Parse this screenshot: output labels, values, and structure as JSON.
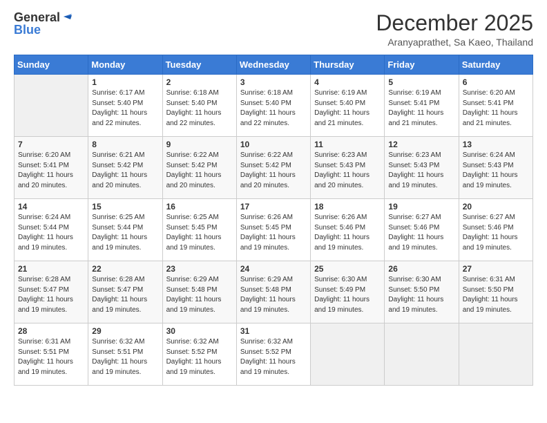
{
  "header": {
    "logo_general": "General",
    "logo_blue": "Blue",
    "title": "December 2025",
    "subtitle": "Aranyaprathet, Sa Kaeo, Thailand"
  },
  "weekdays": [
    "Sunday",
    "Monday",
    "Tuesday",
    "Wednesday",
    "Thursday",
    "Friday",
    "Saturday"
  ],
  "weeks": [
    [
      {
        "day": "",
        "empty": true
      },
      {
        "day": "1",
        "sunrise": "6:17 AM",
        "sunset": "5:40 PM",
        "daylight": "11 hours and 22 minutes."
      },
      {
        "day": "2",
        "sunrise": "6:18 AM",
        "sunset": "5:40 PM",
        "daylight": "11 hours and 22 minutes."
      },
      {
        "day": "3",
        "sunrise": "6:18 AM",
        "sunset": "5:40 PM",
        "daylight": "11 hours and 22 minutes."
      },
      {
        "day": "4",
        "sunrise": "6:19 AM",
        "sunset": "5:40 PM",
        "daylight": "11 hours and 21 minutes."
      },
      {
        "day": "5",
        "sunrise": "6:19 AM",
        "sunset": "5:41 PM",
        "daylight": "11 hours and 21 minutes."
      },
      {
        "day": "6",
        "sunrise": "6:20 AM",
        "sunset": "5:41 PM",
        "daylight": "11 hours and 21 minutes."
      }
    ],
    [
      {
        "day": "7",
        "sunrise": "6:20 AM",
        "sunset": "5:41 PM",
        "daylight": "11 hours and 20 minutes."
      },
      {
        "day": "8",
        "sunrise": "6:21 AM",
        "sunset": "5:42 PM",
        "daylight": "11 hours and 20 minutes."
      },
      {
        "day": "9",
        "sunrise": "6:22 AM",
        "sunset": "5:42 PM",
        "daylight": "11 hours and 20 minutes."
      },
      {
        "day": "10",
        "sunrise": "6:22 AM",
        "sunset": "5:42 PM",
        "daylight": "11 hours and 20 minutes."
      },
      {
        "day": "11",
        "sunrise": "6:23 AM",
        "sunset": "5:43 PM",
        "daylight": "11 hours and 20 minutes."
      },
      {
        "day": "12",
        "sunrise": "6:23 AM",
        "sunset": "5:43 PM",
        "daylight": "11 hours and 19 minutes."
      },
      {
        "day": "13",
        "sunrise": "6:24 AM",
        "sunset": "5:43 PM",
        "daylight": "11 hours and 19 minutes."
      }
    ],
    [
      {
        "day": "14",
        "sunrise": "6:24 AM",
        "sunset": "5:44 PM",
        "daylight": "11 hours and 19 minutes."
      },
      {
        "day": "15",
        "sunrise": "6:25 AM",
        "sunset": "5:44 PM",
        "daylight": "11 hours and 19 minutes."
      },
      {
        "day": "16",
        "sunrise": "6:25 AM",
        "sunset": "5:45 PM",
        "daylight": "11 hours and 19 minutes."
      },
      {
        "day": "17",
        "sunrise": "6:26 AM",
        "sunset": "5:45 PM",
        "daylight": "11 hours and 19 minutes."
      },
      {
        "day": "18",
        "sunrise": "6:26 AM",
        "sunset": "5:46 PM",
        "daylight": "11 hours and 19 minutes."
      },
      {
        "day": "19",
        "sunrise": "6:27 AM",
        "sunset": "5:46 PM",
        "daylight": "11 hours and 19 minutes."
      },
      {
        "day": "20",
        "sunrise": "6:27 AM",
        "sunset": "5:46 PM",
        "daylight": "11 hours and 19 minutes."
      }
    ],
    [
      {
        "day": "21",
        "sunrise": "6:28 AM",
        "sunset": "5:47 PM",
        "daylight": "11 hours and 19 minutes."
      },
      {
        "day": "22",
        "sunrise": "6:28 AM",
        "sunset": "5:47 PM",
        "daylight": "11 hours and 19 minutes."
      },
      {
        "day": "23",
        "sunrise": "6:29 AM",
        "sunset": "5:48 PM",
        "daylight": "11 hours and 19 minutes."
      },
      {
        "day": "24",
        "sunrise": "6:29 AM",
        "sunset": "5:48 PM",
        "daylight": "11 hours and 19 minutes."
      },
      {
        "day": "25",
        "sunrise": "6:30 AM",
        "sunset": "5:49 PM",
        "daylight": "11 hours and 19 minutes."
      },
      {
        "day": "26",
        "sunrise": "6:30 AM",
        "sunset": "5:50 PM",
        "daylight": "11 hours and 19 minutes."
      },
      {
        "day": "27",
        "sunrise": "6:31 AM",
        "sunset": "5:50 PM",
        "daylight": "11 hours and 19 minutes."
      }
    ],
    [
      {
        "day": "28",
        "sunrise": "6:31 AM",
        "sunset": "5:51 PM",
        "daylight": "11 hours and 19 minutes."
      },
      {
        "day": "29",
        "sunrise": "6:32 AM",
        "sunset": "5:51 PM",
        "daylight": "11 hours and 19 minutes."
      },
      {
        "day": "30",
        "sunrise": "6:32 AM",
        "sunset": "5:52 PM",
        "daylight": "11 hours and 19 minutes."
      },
      {
        "day": "31",
        "sunrise": "6:32 AM",
        "sunset": "5:52 PM",
        "daylight": "11 hours and 19 minutes."
      },
      {
        "day": "",
        "empty": true
      },
      {
        "day": "",
        "empty": true
      },
      {
        "day": "",
        "empty": true
      }
    ]
  ]
}
